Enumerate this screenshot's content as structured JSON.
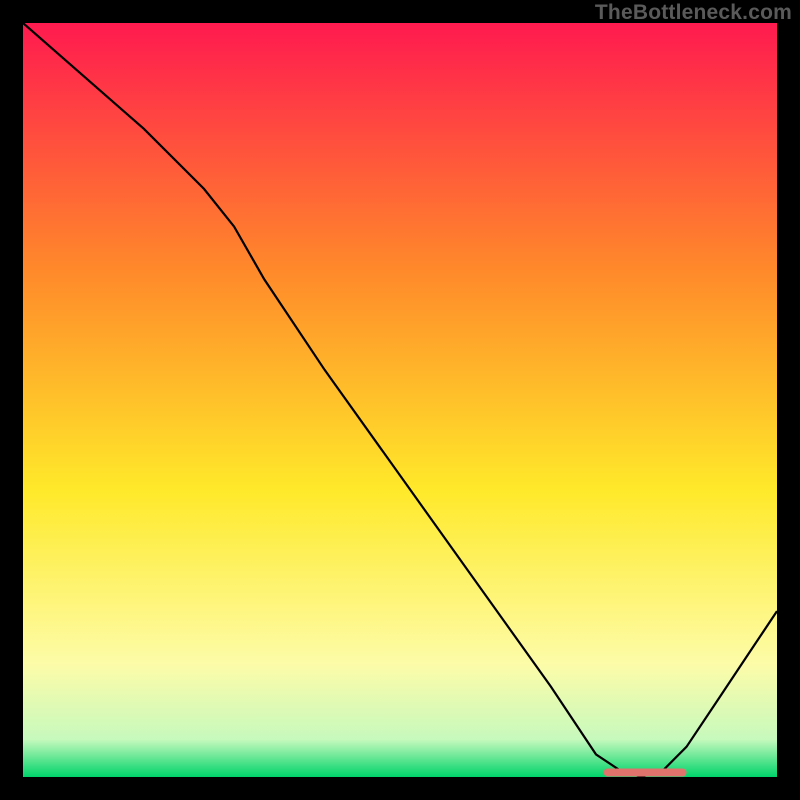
{
  "watermark": "TheBottleneck.com",
  "colors": {
    "bg": "#000000",
    "grad_top": "#ff1a4f",
    "grad_upper_mid": "#ff8a2a",
    "grad_mid": "#ffe92a",
    "grad_lower_mid": "#fdfca8",
    "grad_low": "#c7f9bd",
    "grad_bottom": "#00d46a",
    "curve": "#000000",
    "marker": "#e0736c"
  },
  "chart_data": {
    "type": "line",
    "title": "",
    "xlabel": "",
    "ylabel": "",
    "xlim": [
      0,
      100
    ],
    "ylim": [
      0,
      100
    ],
    "series": [
      {
        "name": "bottleneck-curve",
        "x": [
          0,
          8,
          16,
          24,
          28,
          32,
          40,
          50,
          60,
          70,
          76,
          79,
          82,
          85,
          88,
          92,
          96,
          100
        ],
        "y": [
          100,
          93,
          86,
          78,
          73,
          66,
          54,
          40,
          26,
          12,
          3,
          1,
          0,
          1,
          4,
          10,
          16,
          22
        ]
      }
    ],
    "annotations": [
      {
        "name": "optimal-range-marker",
        "type": "hmarker",
        "x_start": 77,
        "x_end": 88,
        "y": 0.6,
        "color": "#e0736c"
      }
    ]
  }
}
